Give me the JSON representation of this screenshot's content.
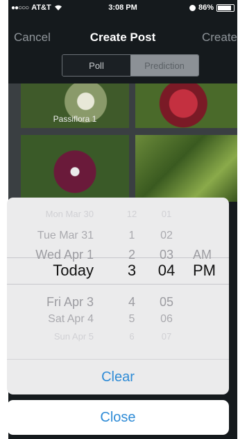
{
  "status_bar": {
    "carrier": "AT&T",
    "signal_dots": "●●○○○",
    "time": "3:08 PM",
    "battery": "86%"
  },
  "nav": {
    "cancel": "Cancel",
    "title": "Create Post",
    "create": "Create"
  },
  "segments": {
    "poll": "Poll",
    "prediction": "Prediction",
    "selected": "Prediction"
  },
  "photos": [
    {
      "caption": "Passiflora 1"
    },
    {
      "caption": ""
    },
    {
      "caption": ""
    },
    {
      "caption": ""
    }
  ],
  "picker": {
    "dates": [
      "Mon Mar 30",
      "Tue Mar 31",
      "Wed Apr 1",
      "Today",
      "Fri Apr 3",
      "Sat Apr 4",
      "Sun Apr 5"
    ],
    "hours": [
      "12",
      "1",
      "2",
      "3",
      "4",
      "5",
      "6"
    ],
    "minutes": [
      "01",
      "02",
      "03",
      "04",
      "05",
      "06",
      "07"
    ],
    "ampm": [
      "AM",
      "PM"
    ],
    "selected": {
      "date": "Today",
      "hour": "3",
      "minute": "04",
      "ampm": "PM"
    }
  },
  "actions": {
    "clear": "Clear",
    "close": "Close"
  },
  "colors": {
    "accent": "#2e8bd6",
    "nav_bg": "#151a1d",
    "sheet_bg": "#ebebec"
  }
}
